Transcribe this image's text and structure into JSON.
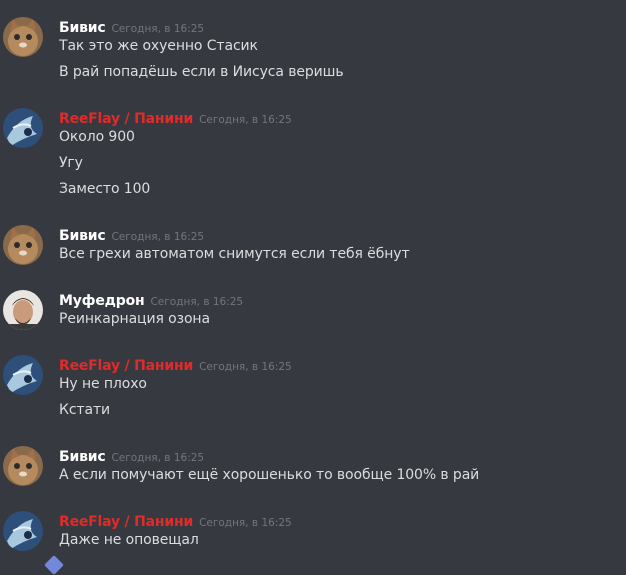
{
  "colors": {
    "background": "#36393f",
    "author_default": "#ffffff",
    "author_highlight": "#e02b2b",
    "timestamp": "#72767d",
    "message_text": "#dcddde"
  },
  "messages": [
    {
      "author": "Бивис",
      "time": "Сегодня, в 16:25",
      "avatar": "cat-avatar",
      "lines": [
        "Так это же охуенно Стасик",
        "В рай попадёшь если в Иисуса веришь"
      ]
    },
    {
      "author": "ReeFlay / Панини",
      "time": "Сегодня, в 16:25",
      "avatar": "anime-avatar",
      "lines": [
        "Около 900",
        "Угу",
        "Заместо 100"
      ]
    },
    {
      "author": "Бивис",
      "time": "Сегодня, в 16:25",
      "avatar": "cat-avatar",
      "lines": [
        "Все грехи автоматом снимутся если тебя ёбнут"
      ]
    },
    {
      "author": "Муфедрон",
      "time": "Сегодня, в 16:25",
      "avatar": "person-avatar",
      "lines": [
        "Реинкарнация озона"
      ]
    },
    {
      "author": "ReeFlay / Панини",
      "time": "Сегодня, в 16:25",
      "avatar": "anime-avatar",
      "lines": [
        "Ну не плохо",
        "Кстати"
      ]
    },
    {
      "author": "Бивис",
      "time": "Сегодня, в 16:25",
      "avatar": "cat-avatar",
      "lines": [
        "А если помучают ещё хорошенько то вообще 100% в рай"
      ]
    },
    {
      "author": "ReeFlay / Панини",
      "time": "Сегодня, в 16:25",
      "avatar": "anime-avatar",
      "lines": [
        "Даже не оповещал"
      ]
    }
  ]
}
